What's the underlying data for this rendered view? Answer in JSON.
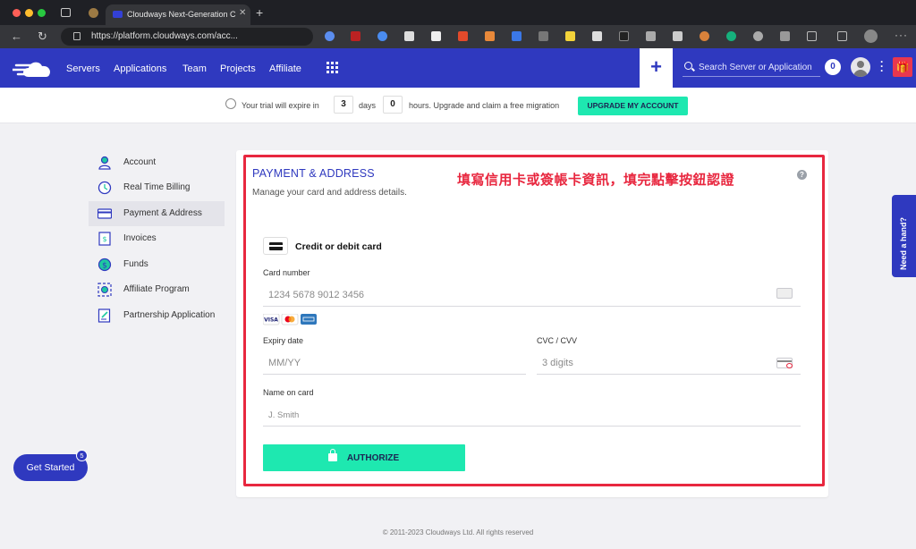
{
  "browser": {
    "tab_title": "Cloudways Next-Generation C",
    "url": "https://platform.cloudways.com/acc..."
  },
  "header": {
    "nav": [
      "Servers",
      "Applications",
      "Team",
      "Projects",
      "Affiliate"
    ],
    "search_placeholder": "Search Server or Application",
    "notification_count": "0",
    "plus_label": "+"
  },
  "trial": {
    "prefix": "Your trial will expire in",
    "days_value": "3",
    "days_label": "days",
    "hours_value": "0",
    "suffix": "hours. Upgrade and claim a free migration",
    "upgrade_label": "UPGRADE MY ACCOUNT"
  },
  "sidebar": {
    "items": [
      {
        "label": "Account",
        "icon": "user-icon"
      },
      {
        "label": "Real Time Billing",
        "icon": "clock-icon"
      },
      {
        "label": "Payment & Address",
        "icon": "credit-card-icon",
        "active": true
      },
      {
        "label": "Invoices",
        "icon": "invoice-icon"
      },
      {
        "label": "Funds",
        "icon": "dollar-icon"
      },
      {
        "label": "Affiliate Program",
        "icon": "affiliate-icon"
      },
      {
        "label": "Partnership Application",
        "icon": "partnership-icon"
      }
    ]
  },
  "payment": {
    "title": "PAYMENT & ADDRESS",
    "subtitle": "Manage your card and address details.",
    "annotation": "填寫信用卡或簽帳卡資訊，填完點擊按鈕認證",
    "help": "?",
    "card_type_label": "Credit or debit card",
    "card_number_label": "Card number",
    "card_number_placeholder": "1234 5678 9012 3456",
    "expiry_label": "Expiry date",
    "expiry_placeholder": "MM/YY",
    "cvc_label": "CVC / CVV",
    "cvc_placeholder": "3 digits",
    "name_label": "Name on card",
    "name_placeholder": "J. Smith",
    "authorize_label": "AUTHORIZE",
    "accepted_cards": [
      "VISA",
      "Mastercard",
      "American Express"
    ]
  },
  "footer": {
    "copyright": "© 2011-2023 Cloudways Ltd. All rights reserved"
  },
  "widgets": {
    "need_hand": "Need a hand?",
    "get_started": "Get Started",
    "get_started_badge": "5"
  },
  "colors": {
    "brand": "#2f39bf",
    "accent": "#1ee8b0",
    "annotation": "#e8273f"
  }
}
